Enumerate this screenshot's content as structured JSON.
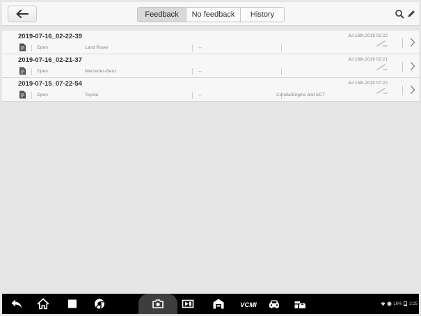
{
  "toolbar": {
    "tabs": [
      {
        "label": "Feedback",
        "active": true
      },
      {
        "label": "No feedback",
        "active": false
      },
      {
        "label": "History",
        "active": false
      }
    ],
    "left_icon": "back-arrow-icon",
    "right_icons": [
      "search-icon",
      "edit-icon"
    ]
  },
  "records": [
    {
      "id": "2019-07-16_02-22-39",
      "date": "Jul 16th,2019 02:22",
      "status": "Open",
      "make": "Land Rover",
      "model": "--",
      "system": ""
    },
    {
      "id": "2019-07-16_02-21-37",
      "date": "Jul 16th,2019 02:21",
      "status": "Open",
      "make": "Mercedes-Benz",
      "model": "--",
      "system": ""
    },
    {
      "id": "2019-07-15_07-22-54",
      "date": "Jul 15th,2019 07:22",
      "status": "Open",
      "make": "Toyota",
      "model": "--",
      "system": "Corolla/Engine and ECT"
    }
  ],
  "navbar": {
    "icons": [
      "back-icon",
      "home-icon",
      "recent-apps-icon",
      "chrome-icon",
      "camera-icon",
      "screen-record-icon",
      "garage-icon",
      "vci-icon",
      "car-icon",
      "vehicle-service-icon"
    ],
    "status": {
      "battery": "16%",
      "time": "2:25"
    }
  },
  "colors": {
    "background": "#e6e6e6",
    "row": "#f7f7f7",
    "navbar": "#000000",
    "active_tab": "#d9d9d9"
  }
}
